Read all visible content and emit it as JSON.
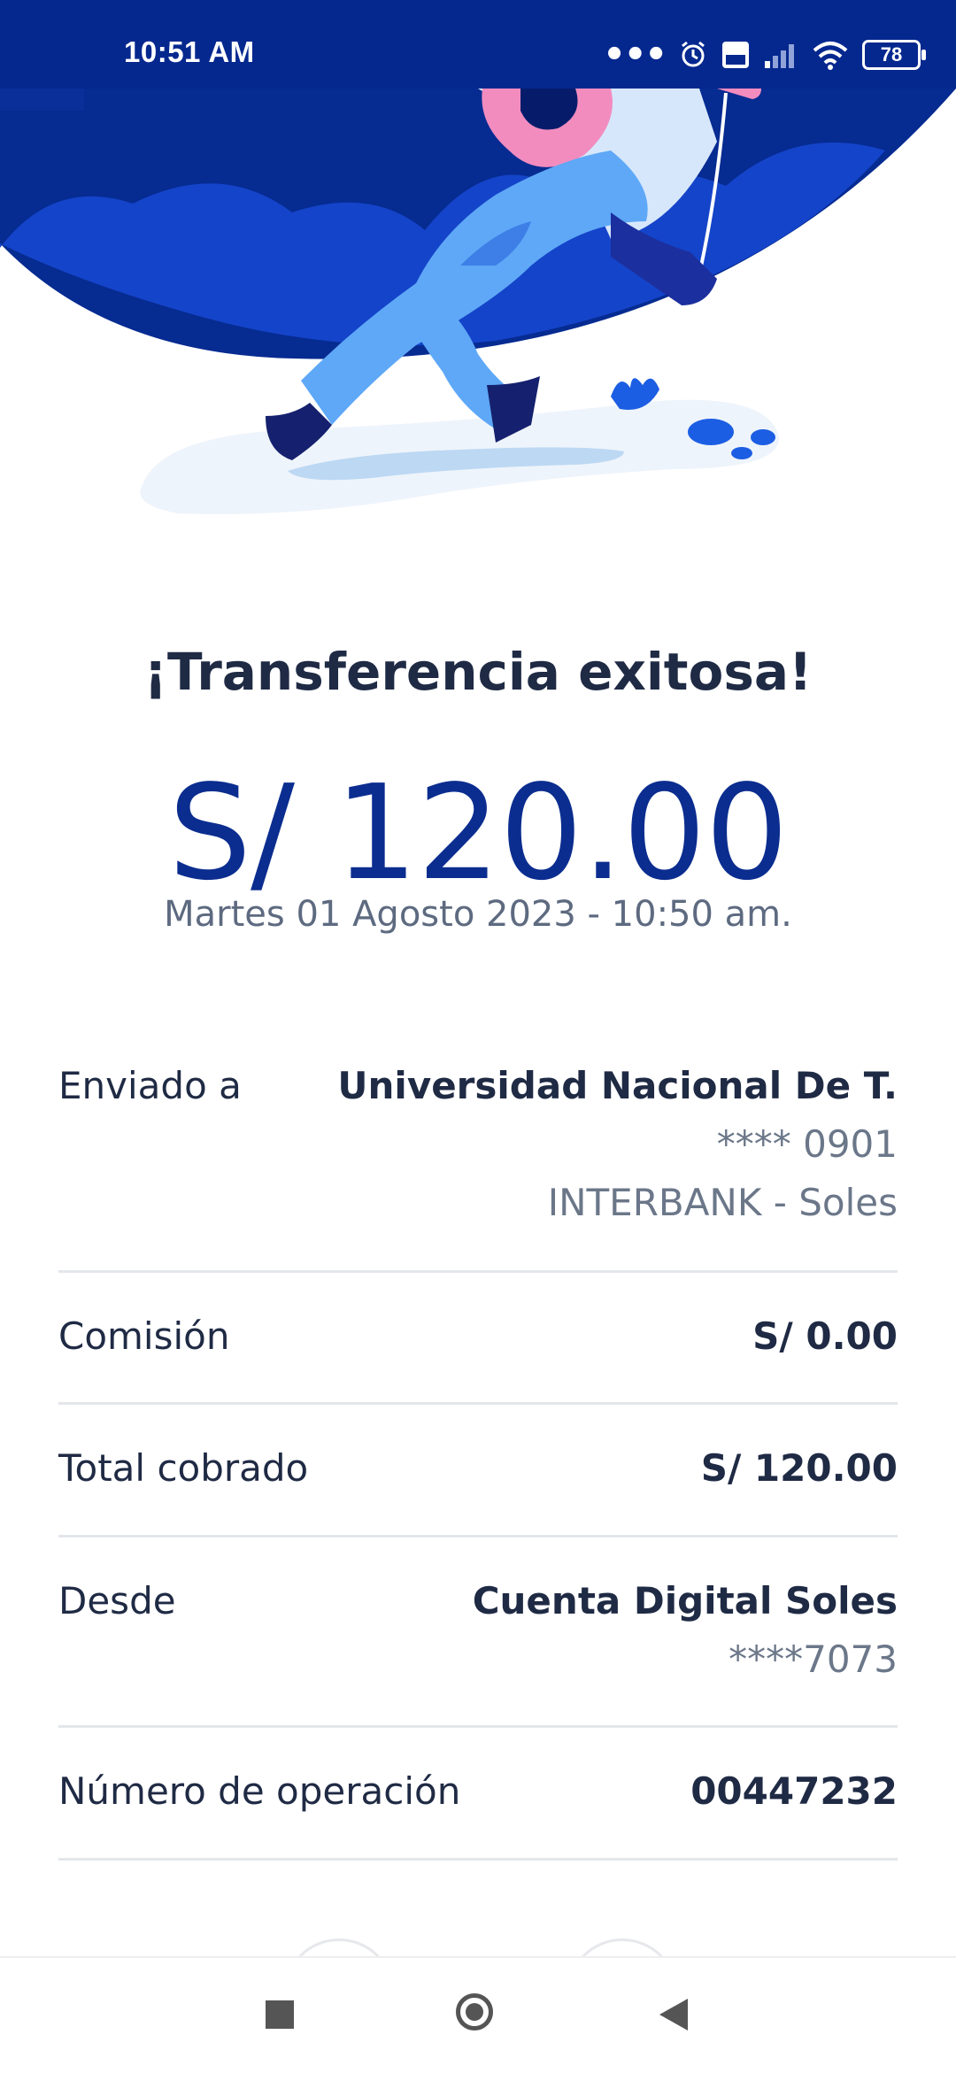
{
  "status_bar": {
    "time": "10:51 AM",
    "battery": "78",
    "icons": [
      "more-dots-icon",
      "alarm-icon",
      "volte-icon",
      "signal-icon",
      "wifi-icon",
      "battery-icon"
    ]
  },
  "receipt": {
    "title": "¡Transferencia exitosa!",
    "amount": "S/ 120.00",
    "datetime": "Martes 01 Agosto 2023 - 10:50 am."
  },
  "details": {
    "sent_to": {
      "label": "Enviado a",
      "name": "Universidad Nacional De T.",
      "account": "**** 0901",
      "bank": "INTERBANK - Soles"
    },
    "commission": {
      "label": "Comisión",
      "value": "S/ 0.00"
    },
    "total": {
      "label": "Total cobrado",
      "value": "S/ 120.00"
    },
    "from": {
      "label": "Desde",
      "value": "Cuenta Digital Soles",
      "account": "****7073"
    },
    "operation": {
      "label": "Número de operación",
      "value": "00447232"
    }
  },
  "nav_bar": {
    "icons": [
      "recents-icon",
      "home-icon",
      "back-icon"
    ]
  },
  "colors": {
    "brand_dark": "#05288f",
    "amount": "#0b2d8f",
    "text": "#1f2a44",
    "muted": "#6b7789"
  }
}
